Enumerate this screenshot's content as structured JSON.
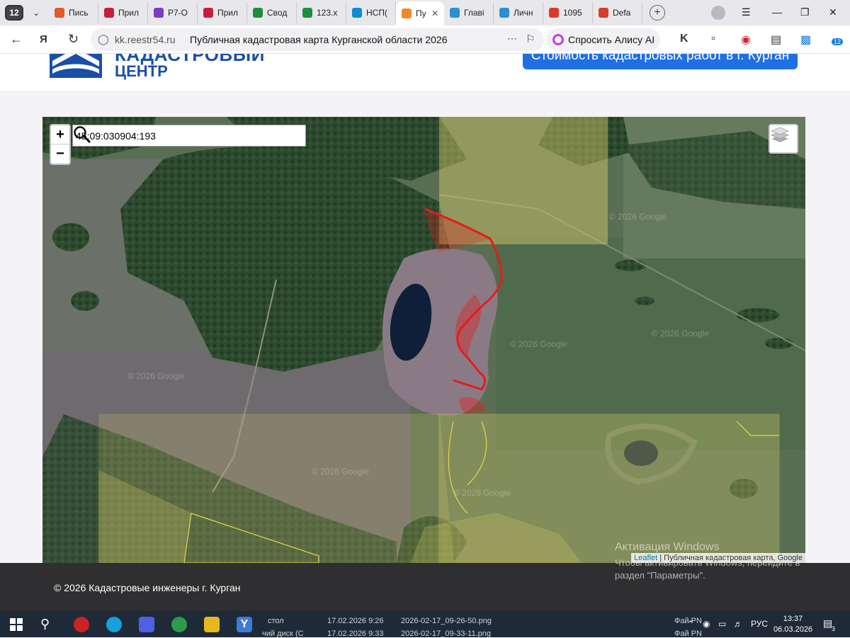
{
  "browser": {
    "tab_count": "12",
    "tabs": [
      {
        "label": "Пись",
        "color": "#e05a2b"
      },
      {
        "label": "Прил",
        "color": "#c81e3c"
      },
      {
        "label": "Р7-О",
        "color": "#7a3cc2"
      },
      {
        "label": "Прил",
        "color": "#c81e3c"
      },
      {
        "label": "Свод",
        "color": "#1e8e3e"
      },
      {
        "label": "123.х",
        "color": "#1e8e3e"
      },
      {
        "label": "НСП(",
        "color": "#0b8bd6"
      },
      {
        "label": "Пу",
        "color": "#f08a24",
        "active": true
      },
      {
        "label": "Главі",
        "color": "#2a8fd4"
      },
      {
        "label": "Личн",
        "color": "#2a8fd4"
      },
      {
        "label": "1095",
        "color": "#d93b2b"
      },
      {
        "label": "Defa",
        "color": "#d93b2b"
      }
    ],
    "new_tab": "+",
    "url_host": "kk.reestr54.ru",
    "page_title": "Публичная кадастровая карта Курганской области 2026",
    "alice_label": "Спросить Алису AI",
    "ext_badge": "12"
  },
  "site": {
    "logo_line1": "КАДАСТРОВЫЙ",
    "logo_line2": "ЦЕНТР",
    "cta_label": "Стоимость кадастровых работ в г. Курган"
  },
  "map": {
    "search_value": "45:09:030904:193",
    "zoom_in": "+",
    "zoom_out": "−",
    "attribution_leaflet": "Leaflet",
    "attribution_rest": " | Публичная кадастровая карта, Google",
    "google_watermark": "© 2026 Google",
    "colors": {
      "selection": "#e51c1c",
      "parcel_fill": "#d9cf6a",
      "parcel_line": "#e6d84a"
    }
  },
  "windows_watermark": {
    "title": "Активация Windows",
    "text": "Чтобы активировать Windows, перейдите в раздел \"Параметры\"."
  },
  "footer": {
    "copyright": "© 2026 Кадастровые инженеры г. Курган"
  },
  "taskbar": {
    "ghost": {
      "desk": "стол",
      "desk2": "чий диск (С",
      "date1": "17.02.2026 9:26",
      "date2": "17.02.2026 9:33",
      "file1": "2026-02-17_09-26-50.png",
      "file2": "2026-02-17_09-33-11.png",
      "f1": "Фай  PN",
      "f2": "Фай  PN"
    },
    "lang": "РУС",
    "time": "13:37",
    "date": "06.03.2026",
    "notif_count": "3"
  }
}
